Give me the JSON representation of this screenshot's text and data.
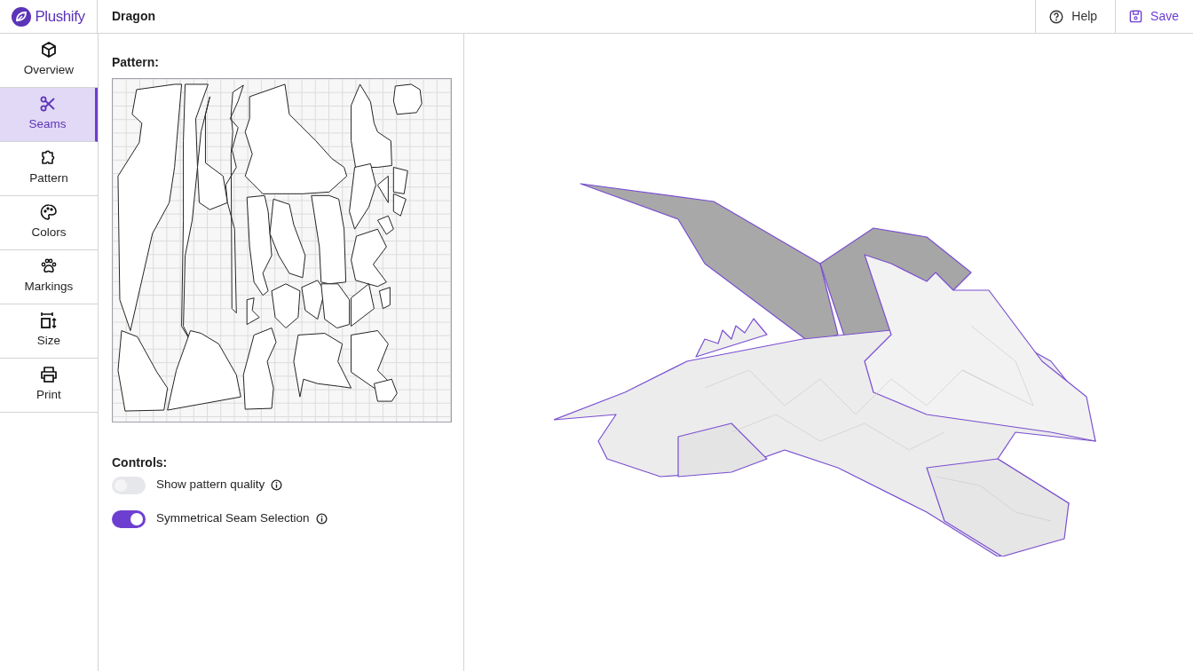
{
  "app": {
    "name": "Plushify"
  },
  "header": {
    "title": "Dragon",
    "actions": [
      {
        "label": "Help",
        "kind": "help"
      },
      {
        "label": "Save",
        "kind": "save"
      }
    ]
  },
  "sidebar": {
    "items": [
      {
        "label": "Overview",
        "selected": false
      },
      {
        "label": "Seams",
        "selected": true
      },
      {
        "label": "Pattern",
        "selected": false
      },
      {
        "label": "Colors",
        "selected": false
      },
      {
        "label": "Markings",
        "selected": false
      },
      {
        "label": "Size",
        "selected": false
      },
      {
        "label": "Print",
        "selected": false
      }
    ]
  },
  "pattern": {
    "heading": "Pattern:"
  },
  "controls": {
    "heading": "Controls:",
    "toggles": [
      {
        "label": "Show pattern quality",
        "on": false
      },
      {
        "label": "Symmetrical Seam Selection",
        "on": true
      }
    ]
  }
}
